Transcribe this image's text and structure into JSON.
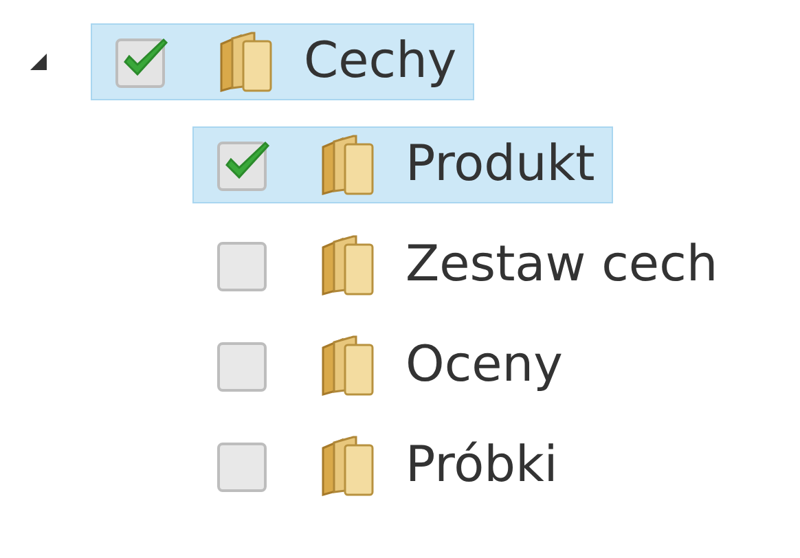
{
  "tree": [
    {
      "label": "Cechy",
      "checked": true,
      "selected": true,
      "expanded": true,
      "children": [
        {
          "label": "Produkt",
          "checked": true,
          "selected": true
        },
        {
          "label": "Zestaw cech",
          "checked": false,
          "selected": false
        },
        {
          "label": "Oceny",
          "checked": false,
          "selected": false
        },
        {
          "label": "Próbki",
          "checked": false,
          "selected": false
        }
      ]
    }
  ]
}
